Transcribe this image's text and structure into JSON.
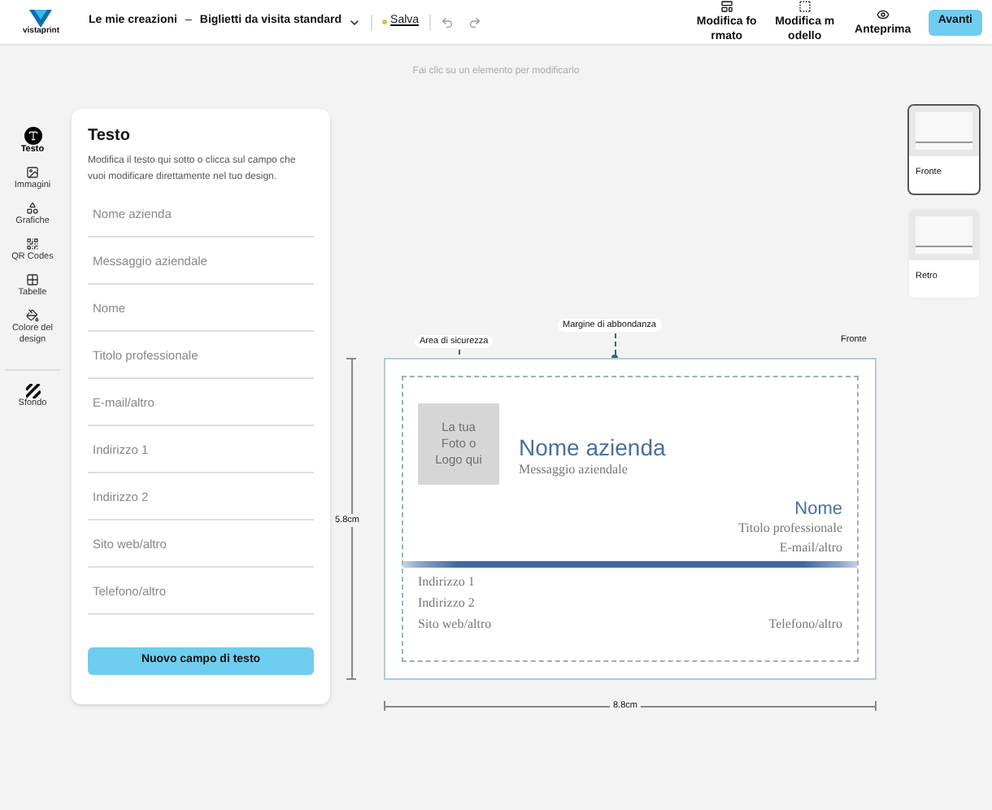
{
  "header": {
    "logo": "vistaprint",
    "breadcrumb": "Le mie creazioni",
    "separator": "–",
    "document": "Biglietti da visita standard",
    "save": {
      "label": "Salva",
      "unsaved": true
    },
    "actions": [
      {
        "lines": [
          "Modifica fo",
          "rmato"
        ]
      },
      {
        "lines": [
          "Modifica m",
          "odello"
        ]
      },
      {
        "lines": [
          "Anteprima"
        ]
      }
    ],
    "next": "Avanti"
  },
  "hint": "Fai clic su un elemento per modificarlo",
  "rail": {
    "items": [
      {
        "label": "Testo",
        "selected": true
      },
      {
        "label": "Immagini",
        "selected": false
      },
      {
        "label": "Grafiche",
        "selected": false
      },
      {
        "label": "QR Codes",
        "selected": false
      },
      {
        "label": "Tabelle",
        "selected": false
      },
      {
        "label": "Colore del design",
        "selected": false
      },
      {
        "label": "Sfondo",
        "selected": false
      }
    ]
  },
  "panel": {
    "title": "Testo",
    "description": "Modifica il testo qui sotto o clicca sul campo che vuoi modificare direttamente nel tuo design.",
    "fields": [
      {
        "placeholder": "Nome azienda"
      },
      {
        "placeholder": "Messaggio aziendale"
      },
      {
        "placeholder": "Nome"
      },
      {
        "placeholder": "Titolo professionale"
      },
      {
        "placeholder": "E-mail/altro"
      },
      {
        "placeholder": "Indirizzo 1"
      },
      {
        "placeholder": "Indirizzo 2"
      },
      {
        "placeholder": "Sito web/altro"
      },
      {
        "placeholder": "Telefono/altro"
      }
    ],
    "button": "Nuovo campo di testo"
  },
  "canvas": {
    "safe_area_label": "Area di sicurezza",
    "bleed_label": "Margine di abbondanza",
    "side_label": "Fronte",
    "height_label": "5.8cm",
    "width_label": "8.8cm",
    "card": {
      "logo_placeholder": "La tua Foto o Logo qui",
      "company": "Nome azienda",
      "message": "Messaggio aziendale",
      "name": "Nome",
      "title": "Titolo professionale",
      "email": "E-mail/altro",
      "address_1": "Indirizzo 1",
      "address_2": "Indirizzo 2",
      "website": "Sito web/altro",
      "phone": "Telefono/altro"
    }
  },
  "sides": [
    {
      "label": "Fronte",
      "selected": true
    },
    {
      "label": "Retro",
      "selected": false
    }
  ]
}
